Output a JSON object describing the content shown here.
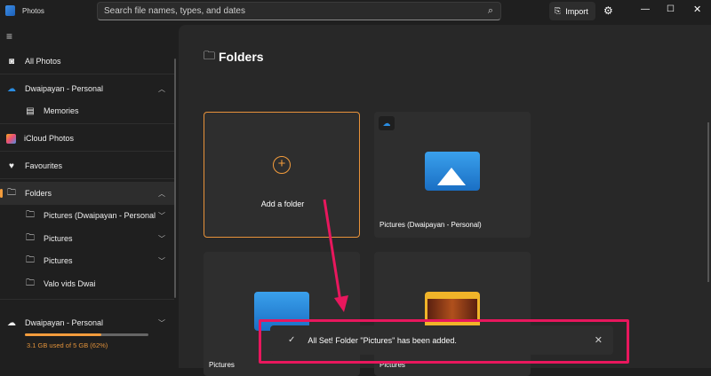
{
  "app": {
    "title": "Photos"
  },
  "search": {
    "placeholder": "Search file names, types, and dates"
  },
  "toolbar": {
    "import_label": "Import"
  },
  "sidebar": {
    "items": [
      {
        "label": "All Photos",
        "icon": "photos-icon"
      },
      {
        "label": "Dwaipayan - Personal",
        "icon": "onedrive-icon"
      },
      {
        "label": "Memories",
        "icon": "memories-icon"
      },
      {
        "label": "iCloud Photos",
        "icon": "icloud-icon"
      },
      {
        "label": "Favourites",
        "icon": "heart-icon"
      },
      {
        "label": "Folders",
        "icon": "folder-icon"
      },
      {
        "label": "Pictures (Dwaipayan - Personal",
        "icon": "folder-icon"
      },
      {
        "label": "Pictures",
        "icon": "folder-icon"
      },
      {
        "label": "Pictures",
        "icon": "folder-icon"
      },
      {
        "label": "Valo vids Dwai",
        "icon": "folder-icon"
      }
    ],
    "storage": {
      "account": "Dwaipayan - Personal",
      "text": "3.1 GB used of 5 GB (62%)",
      "percent": 62
    }
  },
  "main": {
    "title": "Folders",
    "add_folder": "Add a folder",
    "cards": [
      {
        "label": "Pictures (Dwaipayan - Personal)"
      },
      {
        "label": "Pictures"
      },
      {
        "label": "Pictures"
      }
    ]
  },
  "toast": {
    "message": "All Set! Folder \"Pictures\" has been added."
  },
  "colors": {
    "accent": "#f39c3c",
    "highlight": "#e8175d"
  }
}
